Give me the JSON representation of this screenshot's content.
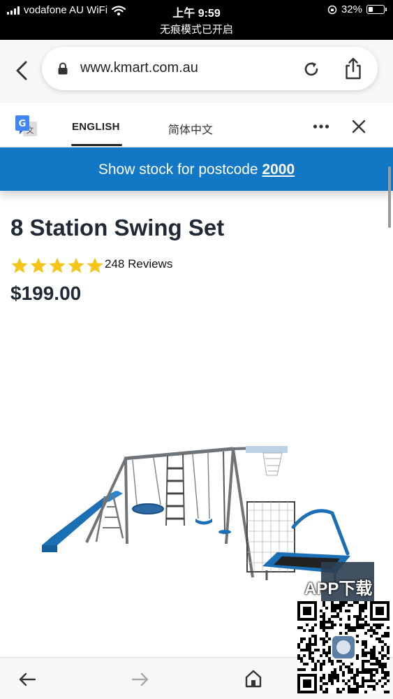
{
  "status_bar": {
    "carrier": "vodafone AU WiFi",
    "time": "上午 9:59",
    "battery_percent": "32%",
    "battery_level": 0.32
  },
  "private_mode_banner": "无痕模式已开启",
  "browser": {
    "url": "www.kmart.com.au"
  },
  "translate_bar": {
    "tabs": [
      {
        "label": "ENGLISH",
        "selected": true
      },
      {
        "label": "简体中文",
        "selected": false
      }
    ]
  },
  "postcode_bar": {
    "text": "Show stock for postcode ",
    "postcode": "2000",
    "background": "#1277c4"
  },
  "product": {
    "title": "8 Station Swing Set",
    "rating": 5,
    "reviews": "248 Reviews",
    "price": "$199.00"
  },
  "overlay": {
    "label": "APP下载"
  },
  "icons": [
    "back-chevron-icon",
    "lock-icon",
    "reload-icon",
    "share-icon",
    "google-translate-icon",
    "more-icon",
    "close-icon",
    "star-icon",
    "nav-back-icon",
    "nav-forward-icon",
    "home-icon",
    "qr-code"
  ]
}
